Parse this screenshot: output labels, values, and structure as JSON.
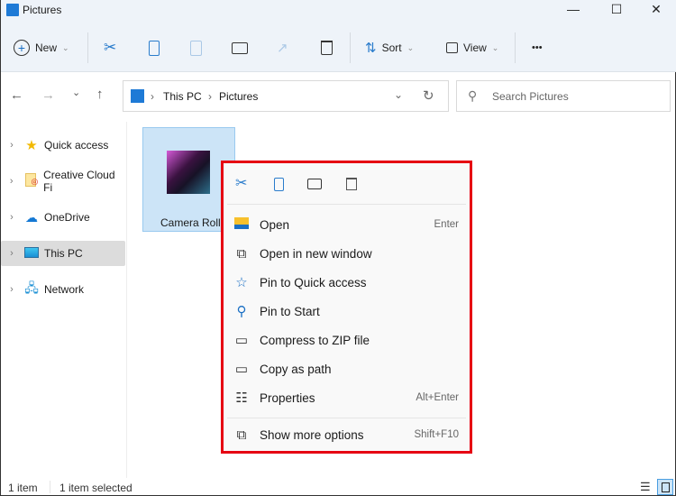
{
  "window": {
    "title": "Pictures",
    "minimize": "—",
    "maximize": "☐",
    "close": "✕"
  },
  "toolbar": {
    "new_label": "New",
    "sort_label": "Sort",
    "view_label": "View",
    "more": "•••"
  },
  "nav": {
    "back": "←",
    "forward": "→",
    "recent": "⌄",
    "up": "↑"
  },
  "address": {
    "segments": [
      "This PC",
      "Pictures"
    ],
    "sep": "›"
  },
  "search": {
    "placeholder": "Search Pictures"
  },
  "sidebar": {
    "items": [
      {
        "label": "Quick access",
        "icon": "star-icon"
      },
      {
        "label": "Creative Cloud Fi",
        "icon": "creative-cloud-icon"
      },
      {
        "label": "OneDrive",
        "icon": "cloud-icon"
      },
      {
        "label": "This PC",
        "icon": "monitor-icon",
        "selected": true
      },
      {
        "label": "Network",
        "icon": "network-icon"
      }
    ]
  },
  "content": {
    "folder": {
      "name": "Camera Roll",
      "selected": true
    }
  },
  "context_menu": {
    "items": [
      {
        "label": "Open",
        "shortcut": "Enter",
        "icon": "folder-icon"
      },
      {
        "label": "Open in new window",
        "shortcut": "",
        "icon": "open-new-window-icon"
      },
      {
        "label": "Pin to Quick access",
        "shortcut": "",
        "icon": "star-icon"
      },
      {
        "label": "Pin to Start",
        "shortcut": "",
        "icon": "pin-icon"
      },
      {
        "label": "Compress to ZIP file",
        "shortcut": "",
        "icon": "zip-icon"
      },
      {
        "label": "Copy as path",
        "shortcut": "",
        "icon": "path-icon"
      },
      {
        "label": "Properties",
        "shortcut": "Alt+Enter",
        "icon": "properties-icon"
      }
    ],
    "more": {
      "label": "Show more options",
      "shortcut": "Shift+F10"
    },
    "highlight_color": "#e60012"
  },
  "status": {
    "count": "1 item",
    "selected": "1 item selected"
  }
}
